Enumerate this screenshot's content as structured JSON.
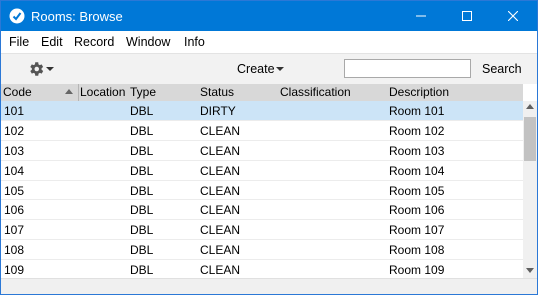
{
  "window": {
    "title": "Rooms: Browse"
  },
  "menu": [
    "File",
    "Edit",
    "Record",
    "Window",
    "Info"
  ],
  "toolbar": {
    "create_label": "Create",
    "search_value": "",
    "search_label": "Search"
  },
  "columns": [
    "Code",
    "Location",
    "Type",
    "Status",
    "Classification",
    "Description"
  ],
  "rows": [
    {
      "code": "101",
      "location": "",
      "type": "DBL",
      "status": "DIRTY",
      "classification": "",
      "description": "Room 101"
    },
    {
      "code": "102",
      "location": "",
      "type": "DBL",
      "status": "CLEAN",
      "classification": "",
      "description": "Room 102"
    },
    {
      "code": "103",
      "location": "",
      "type": "DBL",
      "status": "CLEAN",
      "classification": "",
      "description": "Room 103"
    },
    {
      "code": "104",
      "location": "",
      "type": "DBL",
      "status": "CLEAN",
      "classification": "",
      "description": "Room 104"
    },
    {
      "code": "105",
      "location": "",
      "type": "DBL",
      "status": "CLEAN",
      "classification": "",
      "description": "Room 105"
    },
    {
      "code": "106",
      "location": "",
      "type": "DBL",
      "status": "CLEAN",
      "classification": "",
      "description": "Room 106"
    },
    {
      "code": "107",
      "location": "",
      "type": "DBL",
      "status": "CLEAN",
      "classification": "",
      "description": "Room 107"
    },
    {
      "code": "108",
      "location": "",
      "type": "DBL",
      "status": "CLEAN",
      "classification": "",
      "description": "Room 108"
    },
    {
      "code": "109",
      "location": "",
      "type": "DBL",
      "status": "CLEAN",
      "classification": "",
      "description": "Room 109"
    }
  ],
  "colors": {
    "titlebar": "#0078d7",
    "selected_row": "#cce4f7",
    "header_bg": "#d8d8d8",
    "toolbar_bg": "#f2f2f2"
  },
  "icons": {
    "app": "app-icon",
    "settings": "gear-icon",
    "minimize": "minimize-icon",
    "maximize": "maximize-icon",
    "close": "close-icon"
  }
}
